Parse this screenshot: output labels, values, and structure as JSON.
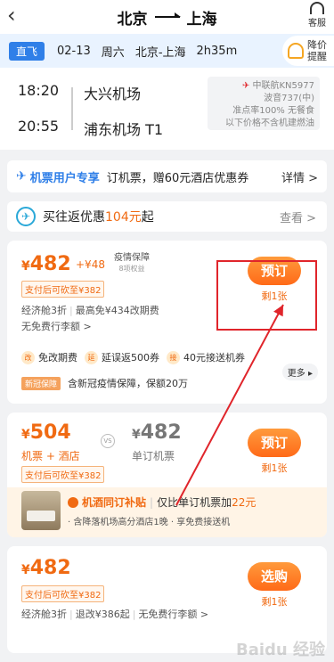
{
  "header": {
    "back_icon": "chevron-left-icon",
    "route_from": "北京",
    "route_to": "上海",
    "service_label": "客服"
  },
  "datebar": {
    "tag": "直飞",
    "date": "02-13",
    "weekday": "周六",
    "route": "北京-上海",
    "duration": "2h35m",
    "remind_label_1": "降价",
    "remind_label_2": "提醒"
  },
  "flight": {
    "dep_time": "18:20",
    "dep_airport": "大兴机场",
    "arr_time": "20:55",
    "arr_airport": "浦东机场 T1",
    "airline": "中联航KN5977",
    "aircraft": "波音737(中)",
    "punctuality": "准点率100% 无餐食",
    "tax_note": "以下价格不含机建燃油"
  },
  "promo_vip": {
    "title": "机票用户专享",
    "text": "订机票，赠60元酒店优惠券",
    "link": "详情 >"
  },
  "promo_return": {
    "text_pre": "买往返优惠",
    "amount": "104元",
    "text_post": "起",
    "link": "查看 >"
  },
  "offer1": {
    "currency": "¥",
    "price": "482",
    "addon": "+¥48",
    "shield_title": "疫情保障",
    "shield_sub": "8项权益",
    "pay_tag": "支付后可砍至¥382",
    "cabin": "经济舱3折",
    "change": "最高免¥434改期费",
    "baggage": "无免费行李额 >",
    "button": "预订",
    "remaining": "剩1张",
    "benefit1": "免改期费",
    "benefit2": "延误返500券",
    "benefit3": "40元接送机券",
    "more": "更多 ▸",
    "covid_tag": "新冠保障",
    "covid_text": "含新冠疫情保障，保额20万",
    "benefit_icons": [
      "改",
      "延",
      "接"
    ]
  },
  "offer2": {
    "currency": "¥",
    "price": "504",
    "label": "机票 + 酒店",
    "vs": "VS",
    "compare_price": "482",
    "compare_label": "单订机票",
    "pay_tag": "支付后可砍至¥382",
    "button": "预订",
    "remaining": "剩1张",
    "hotel_brand": "机酒同订补贴",
    "hotel_text": "仅比单订机票加",
    "hotel_amount": "22元",
    "hotel_sub": "· 含降落机场高分酒店1晚 · 享免费接送机"
  },
  "offer3": {
    "currency": "¥",
    "price": "482",
    "pay_tag": "支付后可砍至¥382",
    "cabin": "经济舱3折",
    "change": "退改¥386起",
    "baggage": "无免费行李额 >",
    "button": "选购",
    "remaining": "剩1张"
  },
  "watermark": "Baidu 经验",
  "colors": {
    "accent": "#f06a12",
    "blue": "#2f7fe8",
    "annotation_red": "#e0252b"
  }
}
